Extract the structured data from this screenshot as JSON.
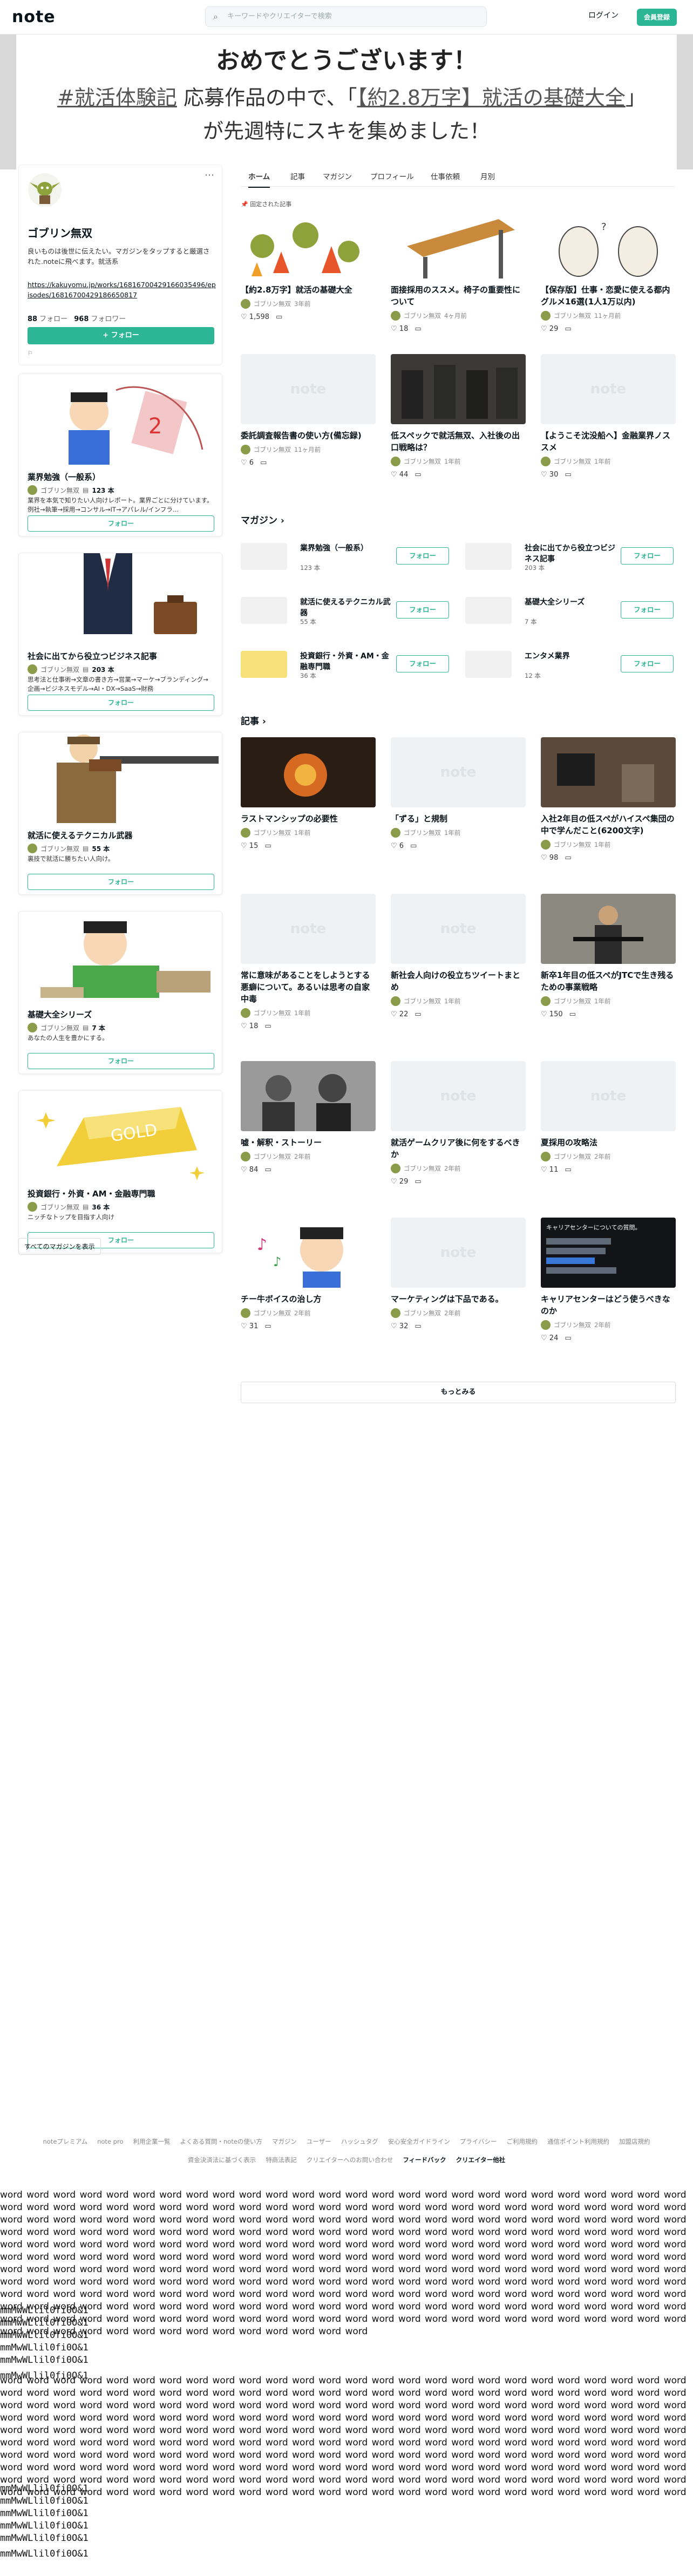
{
  "header": {
    "logo": "note",
    "search_placeholder": "キーワードやクリエイターで検索",
    "login": "ログイン",
    "signup": "会員登録"
  },
  "banner": {
    "title": "おめでとうございます！",
    "announcement_pre_link": "#就活体験記",
    "announcement_mid": " 応募作品の中で、「",
    "announcement_link": "【約2.8万字】就活の基礎大全",
    "announcement_post": "」が先週特にスキを集めました！"
  },
  "profile": {
    "name": "ゴブリン無双",
    "bio": "良いものは後世に伝えたい。マガジンをタップすると厳選された.noteに飛べます。就活系",
    "link": "https://kakuyomu.jp/works/16816700429166035496/episodes/16816700429186650817",
    "following_count": "88",
    "following_label": "フォロー",
    "followers_count": "968",
    "followers_label": "フォロワー",
    "follow_button": "フォロー",
    "menu": "⋯",
    "flag": "⚐"
  },
  "side_magazines": [
    {
      "title": "業界勉強（一般系）",
      "author": "ゴブリン無双",
      "count": "123 本",
      "desc": "業界を本気で知りたい人向けレポート。業界ごとに分けています。例社→執筆→採用→コンサル→IT→アパレル/インフラ…",
      "follow": "フォロー",
      "image": "man-thinking"
    },
    {
      "title": "社会に出てから役立つビジネス記事",
      "author": "ゴブリン無双",
      "count": "203 本",
      "desc": "思考法と仕事術→文章の書き方→営業→マーケ→ブランディング→企画→ビジネスモデル→AI・DX→SaaS→財務",
      "follow": "フォロー",
      "image": "businessman-briefcase"
    },
    {
      "title": "就活に使えるテクニカル武器",
      "author": "ゴブリン無双",
      "count": "55 本",
      "desc": "裏技で就活に勝ちたい人向け。",
      "follow": "フォロー",
      "image": "hunter-rifle"
    },
    {
      "title": "基礎大全シリーズ",
      "author": "ゴブリン無双",
      "count": "7 本",
      "desc": "あなたの人生を豊かにする。",
      "follow": "フォロー",
      "image": "boy-reading"
    },
    {
      "title": "投資銀行・外資・AM・金融専門職",
      "author": "ゴブリン無双",
      "count": "36 本",
      "desc": "ニッチなトップを目指す人向け",
      "follow": "フォロー",
      "image": "gold-bar"
    }
  ],
  "all_magazines": "すべてのマガジンを表示",
  "tabs": [
    "ホーム",
    "記事",
    "マガジン",
    "プロフィール",
    "仕事依頼",
    "月別"
  ],
  "pinned_label": "固定された記事",
  "top_articles": [
    {
      "title": "【約2.8万字】就活の基礎大全",
      "author": "ゴブリン無双",
      "date": "3年前",
      "likes": "1,598",
      "image": "goblins"
    },
    {
      "title": "面接採用のススメ。椅子の重要性について",
      "author": "ゴブリン無双",
      "date": "4ヶ月前",
      "likes": "18",
      "image": "chair"
    },
    {
      "title": "【保存版】仕事・恋愛に使える都内グルメ16選(1人1万以内)",
      "author": "ゴブリン無双",
      "date": "11ヶ月前",
      "likes": "29",
      "image": "alpaca"
    },
    {
      "title": "委託調査報告書の使い方(備忘録)",
      "author": "ゴブリン無双",
      "date": "11ヶ月前",
      "likes": "6",
      "image": "note"
    },
    {
      "title": "低スペックで就活無双、入社後の出口戦略は？",
      "author": "ゴブリン無双",
      "date": "1年前",
      "likes": "44",
      "image": "soldiers"
    },
    {
      "title": "【ようこそ沈没船へ】金融業界ノススメ",
      "author": "ゴブリン無双",
      "date": "1年前",
      "likes": "30",
      "image": "note"
    }
  ],
  "magazine_section": "マガジン",
  "magazines_grid": [
    {
      "title": "業界勉強（一般系）",
      "count": "123 本",
      "follow": "フォロー"
    },
    {
      "title": "社会に出てから役立つビジネス記事",
      "count": "203 本",
      "follow": "フォロー"
    },
    {
      "title": "就活に使えるテクニカル武器",
      "count": "55 本",
      "follow": "フォロー"
    },
    {
      "title": "基礎大全シリーズ",
      "count": "7 本",
      "follow": "フォロー"
    },
    {
      "title": "投資銀行・外資・AM・金融専門職",
      "count": "36 本",
      "follow": "フォロー"
    },
    {
      "title": "エンタメ業界",
      "count": "12 本",
      "follow": "フォロー"
    }
  ],
  "articles_section": "記事",
  "articles": [
    {
      "title": "ラストマンシップの必要性",
      "author": "ゴブリン無双",
      "date": "1年前",
      "likes": "15"
    },
    {
      "title": "「ずる」と規制",
      "author": "ゴブリン無双",
      "date": "1年前",
      "likes": "6"
    },
    {
      "title": "入社2年目の低スペがハイスペ集団の中で学んだこと(6200文字)",
      "author": "ゴブリン無双",
      "date": "1年前",
      "likes": "98"
    },
    {
      "title": "常に意味があることをしようとする悪癖について。あるいは思考の自家中毒",
      "author": "ゴブリン無双",
      "date": "1年前",
      "likes": "18"
    },
    {
      "title": "新社会人向けの役立ちツイートまとめ",
      "author": "ゴブリン無双",
      "date": "1年前",
      "likes": "22"
    },
    {
      "title": "新卒1年目の低スペがJTCで生き残るための事業戦略",
      "author": "ゴブリン無双",
      "date": "1年前",
      "likes": "150"
    },
    {
      "title": "嘘・解釈・ストーリー",
      "author": "ゴブリン無双",
      "date": "2年前",
      "likes": "84"
    },
    {
      "title": "就活ゲームクリア後に何をするべきか",
      "author": "ゴブリン無双",
      "date": "2年前",
      "likes": "29"
    },
    {
      "title": "夏採用の攻略法",
      "author": "ゴブリン無双",
      "date": "2年前",
      "likes": "11"
    },
    {
      "title": "チー牛ボイスの治し方",
      "author": "ゴブリン無双",
      "date": "2年前",
      "likes": "31"
    },
    {
      "title": "マーケティングは下品である。",
      "author": "ゴブリン無双",
      "date": "2年前",
      "likes": "32"
    },
    {
      "title": "キャリアセンターはどう使うべきなのか",
      "author": "ゴブリン無双",
      "date": "2年前",
      "likes": "24"
    }
  ],
  "career_thumb_title": "キャリアセンターについての質問。",
  "more_button": "もっとみる",
  "footer": {
    "row1": [
      "noteプレミアム",
      "note pro",
      "利用企業一覧",
      "よくある質問・noteの使い方",
      "マガジン",
      "ユーザー",
      "ハッシュタグ",
      "安心安全ガイドライン",
      "プライバシー",
      "ご利用規約",
      "通信ポイント利用規約",
      "加盟店規約"
    ],
    "row2": [
      "資金決済法に基づく表示",
      "特商法表記",
      "クリエイターへのお問い合わせ",
      "フィードバック",
      "クリエイター他社"
    ]
  },
  "test_text": {
    "word": "word",
    "mono_lines": [
      "mmMwWLlil0fi0O&1",
      "mmMwWLlil0fi0O&1",
      "mmMwWLlil0fi0O&1",
      "mmMwWLlil0fi0O&1",
      "mmMwWLlil0fi0O&1"
    ],
    "mono_last": "mmMwWLlil0fi0O&1"
  }
}
